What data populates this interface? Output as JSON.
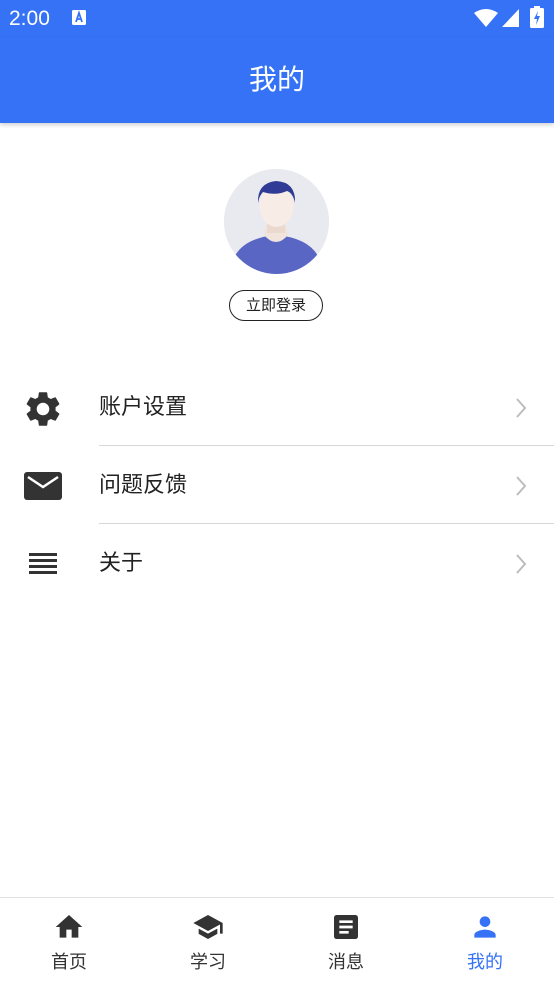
{
  "status_bar": {
    "time": "2:00",
    "notification_icon": "a-letter-icon",
    "wifi_icon": "wifi-icon",
    "signal_icon": "signal-icon",
    "battery_icon": "battery-charging-icon"
  },
  "app_bar": {
    "title": "我的"
  },
  "profile": {
    "avatar_icon": "avatar-icon",
    "login_label": "立即登录"
  },
  "menu": {
    "items": [
      {
        "icon": "gear-icon",
        "label": "账户设置"
      },
      {
        "icon": "mail-icon",
        "label": "问题反馈"
      },
      {
        "icon": "list-icon",
        "label": "关于"
      }
    ]
  },
  "bottom_nav": {
    "items": [
      {
        "icon": "home-icon",
        "label": "首页",
        "active": false
      },
      {
        "icon": "graduation-cap-icon",
        "label": "学习",
        "active": false
      },
      {
        "icon": "article-icon",
        "label": "消息",
        "active": false
      },
      {
        "icon": "person-icon",
        "label": "我的",
        "active": true
      }
    ]
  },
  "colors": {
    "primary": "#3572F6",
    "text": "#222222",
    "divider": "#D8D8D8",
    "icon": "#333333",
    "avatar_shirt": "#5966C4",
    "avatar_hair": "#2F3B94"
  }
}
